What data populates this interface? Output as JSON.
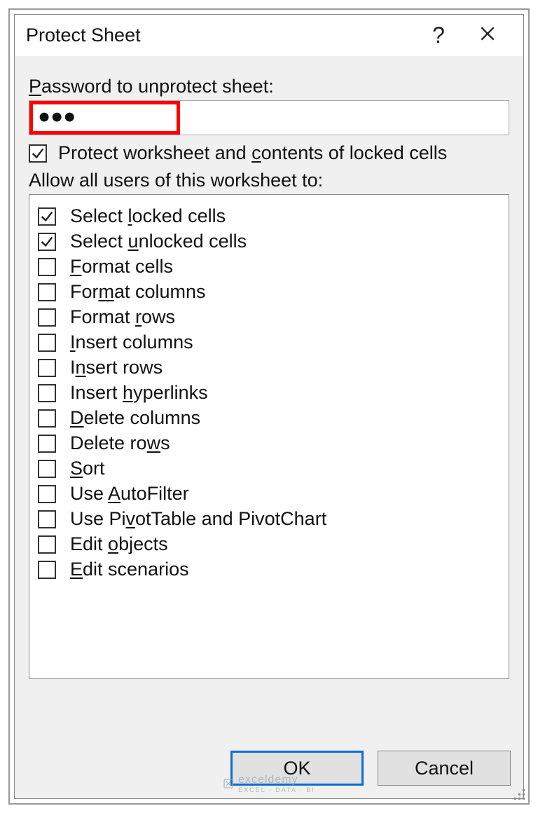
{
  "dialog": {
    "title": "Protect Sheet",
    "password_label_pre": "P",
    "password_label_rest": "assword to unprotect sheet:",
    "password_value": "●●●",
    "protect_chk_pre": "Protect worksheet and ",
    "protect_chk_u": "c",
    "protect_chk_post": "ontents of locked cells",
    "allow_label": "Allow all users of this worksheet to:"
  },
  "options": [
    {
      "checked": true,
      "pre": "Select ",
      "u": "l",
      "post": "ocked cells"
    },
    {
      "checked": true,
      "pre": "Select ",
      "u": "u",
      "post": "nlocked cells"
    },
    {
      "checked": false,
      "pre": "",
      "u": "F",
      "post": "ormat cells"
    },
    {
      "checked": false,
      "pre": "For",
      "u": "m",
      "post": "at columns"
    },
    {
      "checked": false,
      "pre": "Format ",
      "u": "r",
      "post": "ows"
    },
    {
      "checked": false,
      "pre": "",
      "u": "I",
      "post": "nsert columns"
    },
    {
      "checked": false,
      "pre": "I",
      "u": "n",
      "post": "sert rows"
    },
    {
      "checked": false,
      "pre": "Insert ",
      "u": "h",
      "post": "yperlinks"
    },
    {
      "checked": false,
      "pre": "",
      "u": "D",
      "post": "elete columns"
    },
    {
      "checked": false,
      "pre": "Delete ro",
      "u": "w",
      "post": "s"
    },
    {
      "checked": false,
      "pre": "",
      "u": "S",
      "post": "ort"
    },
    {
      "checked": false,
      "pre": "Use ",
      "u": "A",
      "post": "utoFilter"
    },
    {
      "checked": false,
      "pre": "Use Pi",
      "u": "v",
      "post": "otTable and PivotChart"
    },
    {
      "checked": false,
      "pre": "Edit ",
      "u": "o",
      "post": "bjects"
    },
    {
      "checked": false,
      "pre": "",
      "u": "E",
      "post": "dit scenarios"
    }
  ],
  "buttons": {
    "ok": "OK",
    "cancel": "Cancel"
  },
  "watermark": {
    "main": "exceldemy",
    "sub": "EXCEL · DATA · BI"
  }
}
